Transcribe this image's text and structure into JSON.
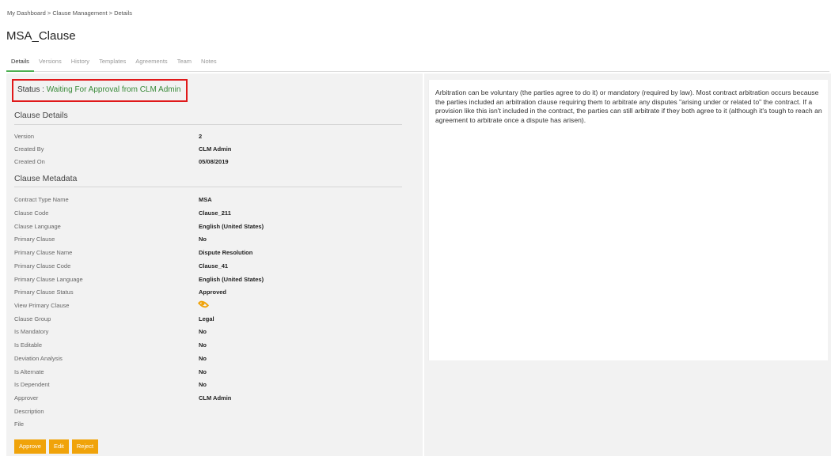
{
  "breadcrumb": "My Dashboard > Clause Management > Details",
  "page_title": "MSA_Clause",
  "tabs": [
    {
      "label": "Details"
    },
    {
      "label": "Versions"
    },
    {
      "label": "History"
    },
    {
      "label": "Templates"
    },
    {
      "label": "Agreements"
    },
    {
      "label": "Team"
    },
    {
      "label": "Notes"
    }
  ],
  "active_tab": "Details",
  "status": {
    "label": "Status :",
    "value": "Waiting For Approval from CLM Admin"
  },
  "clause_details": {
    "title": "Clause Details",
    "rows": [
      {
        "label": "Version",
        "value": "2"
      },
      {
        "label": "Created By",
        "value": "CLM Admin"
      },
      {
        "label": "Created On",
        "value": "05/08/2019"
      }
    ]
  },
  "clause_metadata": {
    "title": "Clause Metadata",
    "rows": [
      {
        "label": "Contract Type Name",
        "value": "MSA"
      },
      {
        "label": "Clause Code",
        "value": "Clause_211"
      },
      {
        "label": "Clause Language",
        "value": "English (United States)"
      },
      {
        "label": "Primary Clause",
        "value": "No"
      },
      {
        "label": "Primary Clause Name",
        "value": "Dispute Resolution"
      },
      {
        "label": "Primary Clause Code",
        "value": "Clause_41"
      },
      {
        "label": "Primary Clause Language",
        "value": "English (United States)"
      },
      {
        "label": "Primary Clause Status",
        "value": "Approved"
      },
      {
        "label": "View Primary Clause",
        "value": ""
      },
      {
        "label": "Clause Group",
        "value": "Legal"
      },
      {
        "label": "Is Mandatory",
        "value": "No"
      },
      {
        "label": "Is Editable",
        "value": "No"
      },
      {
        "label": "Deviation Analysis",
        "value": "No"
      },
      {
        "label": "Is Alternate",
        "value": "No"
      },
      {
        "label": "Is Dependent",
        "value": "No"
      },
      {
        "label": "Approver",
        "value": "CLM Admin"
      },
      {
        "label": "Description",
        "value": ""
      },
      {
        "label": "File",
        "value": ""
      }
    ]
  },
  "buttons": {
    "approve": "Approve",
    "edit": "Edit",
    "reject": "Reject"
  },
  "clause_text": "Arbitration can be voluntary (the parties agree to do it) or mandatory (required by law). Most contract arbitration occurs because the parties included an arbitration clause requiring them to arbitrate any disputes \"arising under or related to\" the contract. If a provision like this isn't included in the contract, the parties can still arbitrate if they both agree to it (although it's tough to reach an agreement to arbitrate once a dispute has arisen).",
  "colors": {
    "accent": "#f0a30a",
    "status_green": "#3a8a3a",
    "highlight_red": "#e0191a",
    "tab_active": "#4caf50"
  }
}
